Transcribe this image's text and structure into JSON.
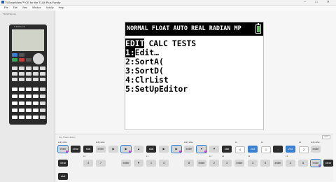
{
  "window": {
    "title": "TI-SmartView™ CE for the TI-84 Plus Family",
    "menu": [
      "File",
      "Edit",
      "View",
      "Window",
      "Activity",
      "Help"
    ]
  },
  "sidebar": {
    "header": "TI-84 Plus CE",
    "calculator_label": "TI-84 Plus CE"
  },
  "screen": {
    "status_bar": "NORMAL FLOAT AUTO REAL RADIAN MP",
    "tabs": [
      "EDIT",
      "CALC",
      "TESTS"
    ],
    "selected_tab": "EDIT",
    "items": [
      {
        "num": "1:",
        "label": "Edit…",
        "selected": true
      },
      {
        "num": "2:",
        "label": "SortA(",
        "selected": false
      },
      {
        "num": "3:",
        "label": "SortD(",
        "selected": false
      },
      {
        "num": "4:",
        "label": "ClrList",
        "selected": false
      },
      {
        "num": "5:",
        "label": "SetUpEditor",
        "selected": false
      }
    ],
    "battery_color": "#5fc85a"
  },
  "key_history": {
    "title": "Key Press History",
    "close_label": "close",
    "rows": [
      [
        {
          "label": "enter",
          "above": "entry solve",
          "style": "gray"
        },
        {
          "label": "clear",
          "above": "",
          "style": "dark"
        },
        {
          "label": "stat",
          "above": "",
          "style": "dark"
        },
        {
          "label": "enter",
          "above": "entry solve",
          "style": "gray"
        },
        {
          "label": "▶",
          "above": "",
          "style": "gray"
        },
        {
          "label": "▶",
          "above": "",
          "style": "gray"
        },
        {
          "label": "▲",
          "above": "",
          "style": "gray"
        },
        {
          "label": "stat",
          "above": "",
          "style": "dark"
        },
        {
          "label": "▶",
          "above": "",
          "style": "gray"
        },
        {
          "label": "▶",
          "above": "",
          "style": "gray"
        },
        {
          "label": "enter",
          "above": "entry solve",
          "style": "gray"
        },
        {
          "label": "▼",
          "above": "",
          "style": "gray"
        },
        {
          "label": "▼",
          "above": "",
          "style": "gray"
        },
        {
          "label": "stat",
          "above": "",
          "style": "dark"
        },
        {
          "label": "4",
          "above": "L4",
          "style": "white"
        },
        {
          "label": "2nd",
          "above": "",
          "style": "blue"
        },
        {
          "label": "1",
          "above": "L1",
          "style": "white"
        },
        {
          "label": ",",
          "above": "",
          "style": "dark"
        },
        {
          "label": "2nd",
          "above": "",
          "style": "blue"
        },
        {
          "label": "2",
          "above": "L2",
          "style": "white"
        },
        {
          "label": "enter",
          "above": "entry solve",
          "style": "gray"
        }
      ],
      [
        {
          "label": "clear",
          "above": "",
          "style": "dark"
        },
        {
          "label": "4",
          "above": "L4",
          "style": "gray"
        },
        {
          "label": "7",
          "above": "",
          "style": "gray"
        },
        {
          "label": "enter",
          "above": "",
          "style": "gray"
        },
        {
          "label": "▼",
          "above": "",
          "style": "gray"
        },
        {
          "label": "1",
          "above": "L1",
          "style": "gray"
        },
        {
          "label": "4",
          "above": "",
          "style": "gray"
        },
        {
          "label": "8",
          "above": "",
          "style": "gray"
        },
        {
          "label": "enter",
          "above": "",
          "style": "gray"
        },
        {
          "label": "2",
          "above": "L2",
          "style": "gray"
        },
        {
          "label": "3",
          "above": "L3",
          "style": "gray"
        },
        {
          "label": "enter",
          "above": "",
          "style": "gray"
        },
        {
          "label": "3",
          "above": "L3",
          "style": "gray"
        },
        {
          "label": "5",
          "above": "",
          "style": "gray"
        },
        {
          "label": "enter",
          "above": "",
          "style": "gray"
        },
        {
          "label": "3",
          "above": "L3",
          "style": "gray"
        },
        {
          "label": "5",
          "above": "",
          "style": "gray"
        },
        {
          "label": "enter",
          "above": "",
          "style": "gray"
        },
        {
          "label": "clear",
          "above": "",
          "style": "dark"
        }
      ],
      [
        {
          "label": "stat",
          "above": "",
          "style": "dark"
        }
      ]
    ]
  },
  "colors": {
    "status_bg": "#000000",
    "highlight": "#000000",
    "key_blue": "#3b7fd1",
    "marker": "#bb44cc"
  }
}
